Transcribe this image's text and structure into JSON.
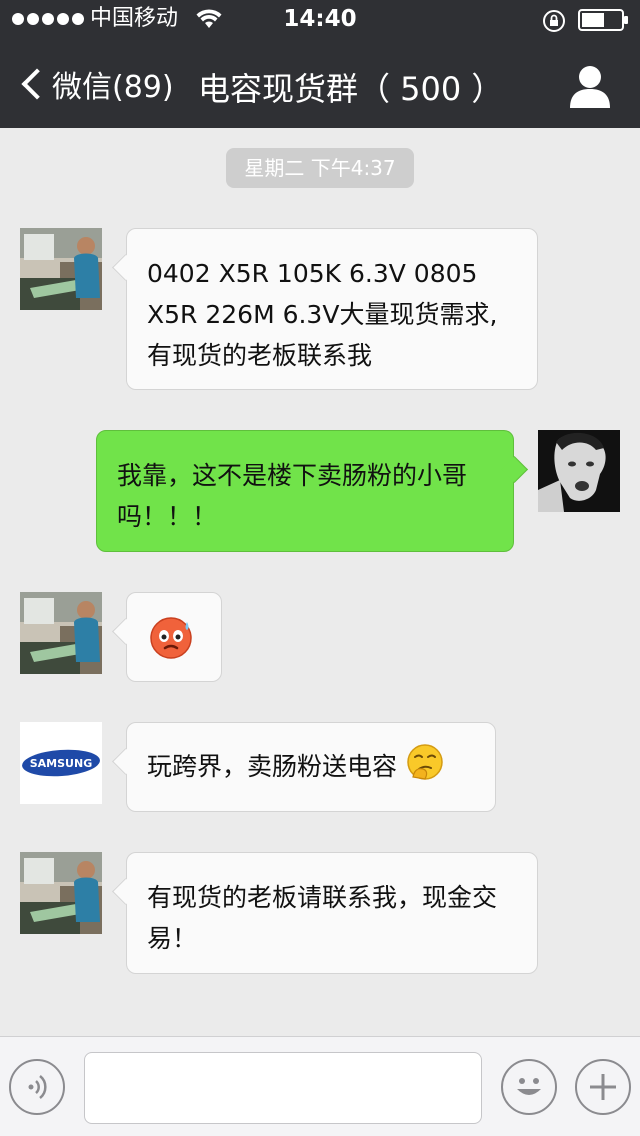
{
  "status_bar": {
    "carrier": "中国移动",
    "time": "14:40"
  },
  "nav": {
    "back_label": "微信(89)",
    "title": "电容现货群（ 500 ）"
  },
  "chat": {
    "timestamp": "星期二 下午4:37",
    "messages": [
      {
        "direction": "in",
        "sender_avatar": "avatar-man-workshop",
        "text": "0402 X5R 105K 6.3V 0805 X5R 226M 6.3V大量现货需求,有现货的老板联系我"
      },
      {
        "direction": "out",
        "sender_avatar": "avatar-bw-portrait",
        "text": "我靠，这不是楼下卖肠粉的小哥吗！！！"
      },
      {
        "direction": "in",
        "sender_avatar": "avatar-man-workshop",
        "emoji": "blush-sweat-emoji"
      },
      {
        "direction": "in",
        "sender_avatar": "avatar-samsung-logo",
        "text": "玩跨界，卖肠粉送电容",
        "emoji": "thinking-emoji"
      },
      {
        "direction": "in",
        "sender_avatar": "avatar-man-workshop",
        "text": "有现货的老板请联系我，现金交易！"
      }
    ]
  },
  "samsung_logo_text": "SAMSUNG",
  "input_bar": {
    "placeholder": ""
  },
  "colors": {
    "nav_background": "#2f3034",
    "chat_background": "#ebebeb",
    "outgoing_bubble": "#71e34a",
    "incoming_bubble": "#fafafa"
  }
}
